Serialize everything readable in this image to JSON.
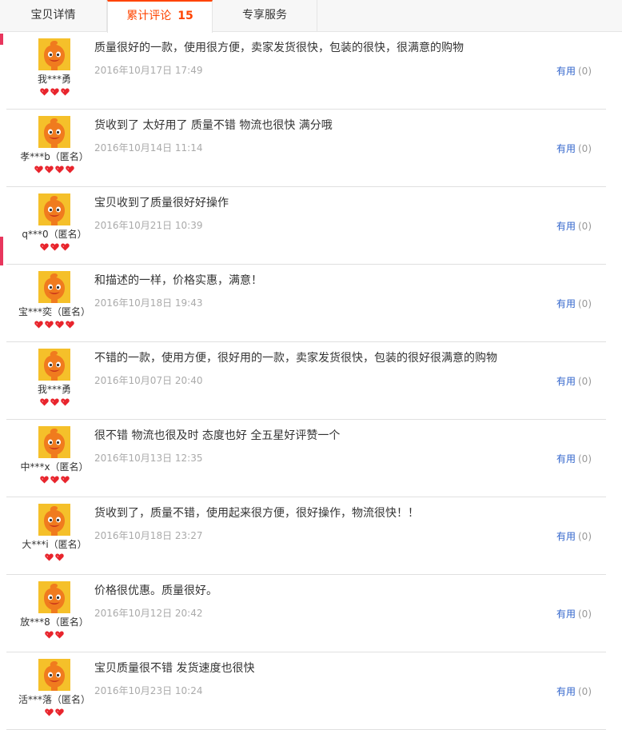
{
  "tabs": [
    {
      "label": "宝贝详情",
      "count": ""
    },
    {
      "label": "累计评论",
      "count": "15"
    },
    {
      "label": "专享服务",
      "count": ""
    }
  ],
  "accent_color": "#ff4400",
  "reviews": [
    {
      "user": "我***勇",
      "hearts": 3,
      "content": "质量很好的一款，使用很方便，卖家发货很快，包装的很快，很满意的购物",
      "date": "2016年10月17日 17:49",
      "useful_label": "有用",
      "useful_count": "(0)"
    },
    {
      "user": "孝***b（匿名）",
      "hearts": 4,
      "content": "货收到了 太好用了 质量不错 物流也很快 满分哦",
      "date": "2016年10月14日 11:14",
      "useful_label": "有用",
      "useful_count": "(0)"
    },
    {
      "user": "q***0（匿名）",
      "hearts": 3,
      "content": "宝贝收到了质量很好好操作",
      "date": "2016年10月21日 10:39",
      "useful_label": "有用",
      "useful_count": "(0)"
    },
    {
      "user": "宝***奕（匿名）",
      "hearts": 4,
      "content": "和描述的一样，价格实惠，满意！",
      "date": "2016年10月18日 19:43",
      "useful_label": "有用",
      "useful_count": "(0)"
    },
    {
      "user": "我***勇",
      "hearts": 3,
      "content": "不错的一款，使用方便，很好用的一款，卖家发货很快，包装的很好很满意的购物",
      "date": "2016年10月07日 20:40",
      "useful_label": "有用",
      "useful_count": "(0)"
    },
    {
      "user": "中***x（匿名）",
      "hearts": 3,
      "content": "很不错 物流也很及时 态度也好 全五星好评赞一个",
      "date": "2016年10月13日 12:35",
      "useful_label": "有用",
      "useful_count": "(0)"
    },
    {
      "user": "大***i（匿名）",
      "hearts": 2,
      "content": "货收到了，质量不错，使用起来很方便，很好操作，物流很快！！",
      "date": "2016年10月18日 23:27",
      "useful_label": "有用",
      "useful_count": "(0)"
    },
    {
      "user": "放***8（匿名）",
      "hearts": 2,
      "content": "价格很优惠。质量很好。",
      "date": "2016年10月12日 20:42",
      "useful_label": "有用",
      "useful_count": "(0)"
    },
    {
      "user": "活***落（匿名）",
      "hearts": 2,
      "content": "宝贝质量很不错 发货速度也很快",
      "date": "2016年10月23日 10:24",
      "useful_label": "有用",
      "useful_count": "(0)"
    }
  ]
}
